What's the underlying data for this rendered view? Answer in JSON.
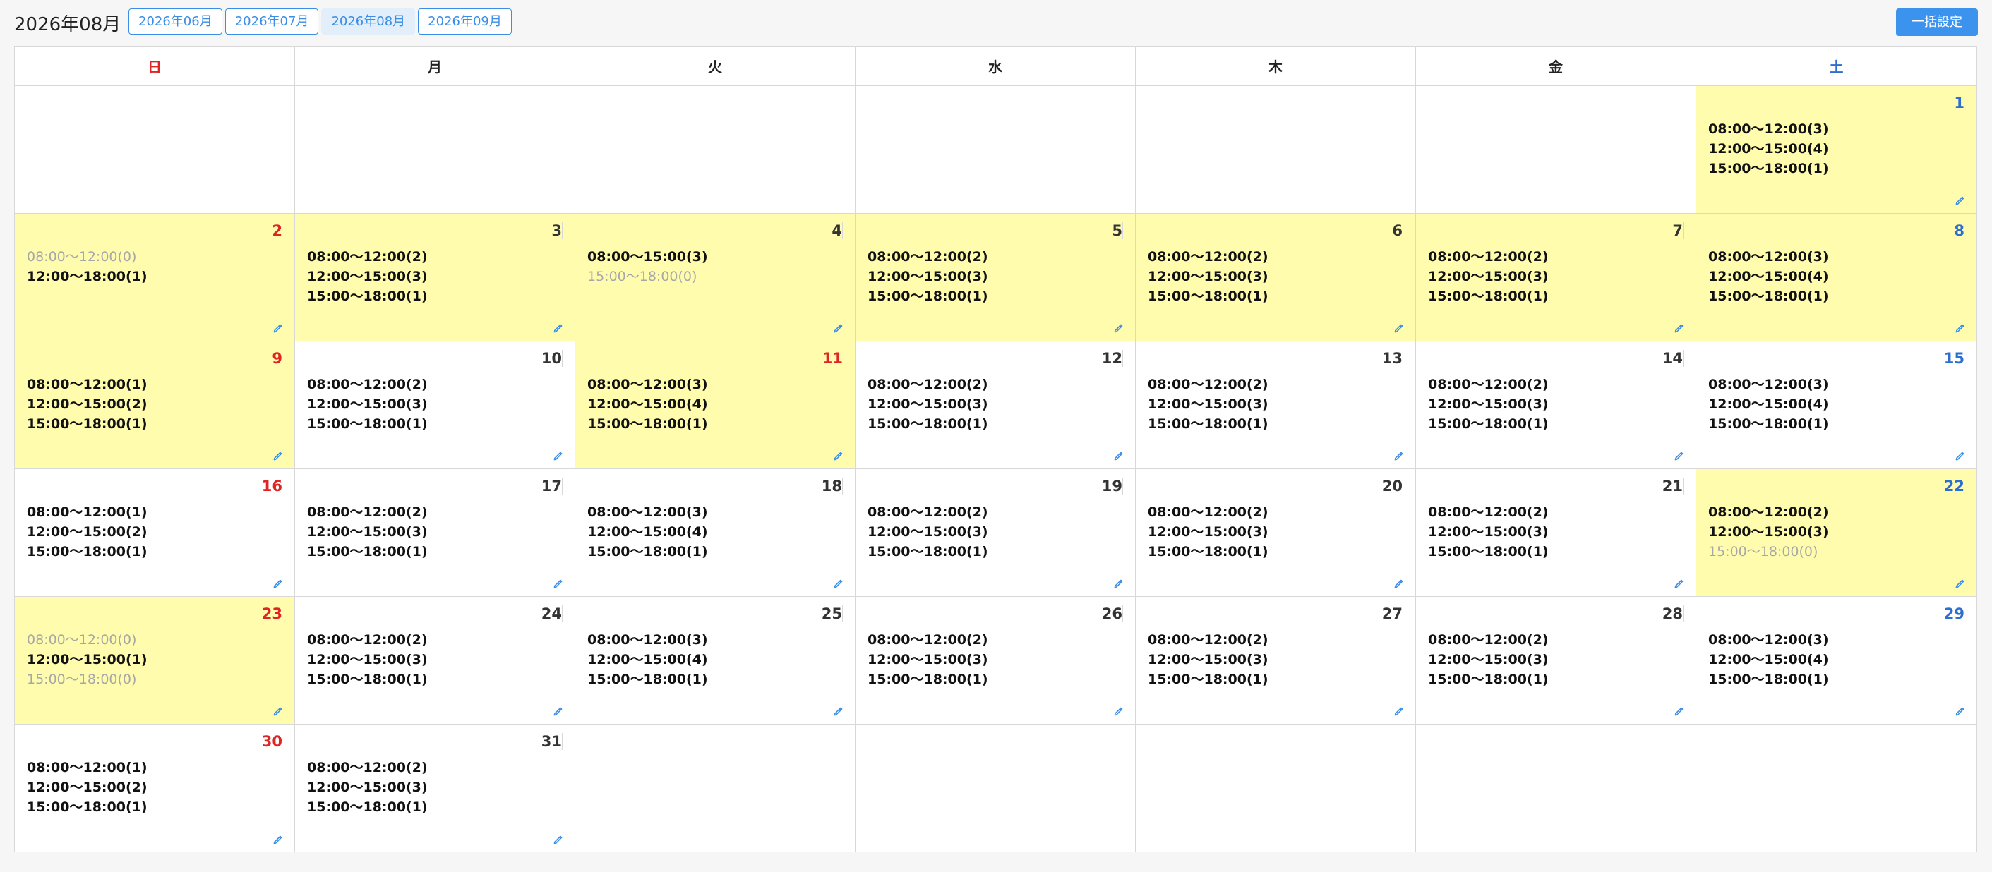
{
  "header": {
    "title": "2026年08月",
    "month_tabs": [
      {
        "label": "2026年06月",
        "active": false
      },
      {
        "label": "2026年07月",
        "active": false
      },
      {
        "label": "2026年08月",
        "active": true
      },
      {
        "label": "2026年09月",
        "active": false
      }
    ],
    "bulk_button_label": "一括設定"
  },
  "colors": {
    "accent": "#3b93ee",
    "highlight": "#fffcae",
    "sunday": "#e02424",
    "saturday": "#2d6fd0"
  },
  "calendar": {
    "weekdays": [
      "日",
      "月",
      "火",
      "水",
      "木",
      "金",
      "土"
    ],
    "weeks": [
      [
        null,
        null,
        null,
        null,
        null,
        null,
        {
          "date": 1,
          "highlight": true,
          "day_type": "sat",
          "slots": [
            {
              "text": "08:00〜12:00(3)",
              "zero": false
            },
            {
              "text": "12:00〜15:00(4)",
              "zero": false
            },
            {
              "text": "15:00〜18:00(1)",
              "zero": false
            }
          ]
        }
      ],
      [
        {
          "date": 2,
          "highlight": true,
          "day_type": "sun",
          "slots": [
            {
              "text": "08:00〜12:00(0)",
              "zero": true
            },
            {
              "text": "12:00〜18:00(1)",
              "zero": false
            }
          ]
        },
        {
          "date": 3,
          "highlight": true,
          "day_type": "weekday",
          "slots": [
            {
              "text": "08:00〜12:00(2)",
              "zero": false
            },
            {
              "text": "12:00〜15:00(3)",
              "zero": false
            },
            {
              "text": "15:00〜18:00(1)",
              "zero": false
            }
          ]
        },
        {
          "date": 4,
          "highlight": true,
          "day_type": "weekday",
          "slots": [
            {
              "text": "08:00〜15:00(3)",
              "zero": false
            },
            {
              "text": "15:00〜18:00(0)",
              "zero": true
            }
          ]
        },
        {
          "date": 5,
          "highlight": true,
          "day_type": "weekday",
          "slots": [
            {
              "text": "08:00〜12:00(2)",
              "zero": false
            },
            {
              "text": "12:00〜15:00(3)",
              "zero": false
            },
            {
              "text": "15:00〜18:00(1)",
              "zero": false
            }
          ]
        },
        {
          "date": 6,
          "highlight": true,
          "day_type": "weekday",
          "slots": [
            {
              "text": "08:00〜12:00(2)",
              "zero": false
            },
            {
              "text": "12:00〜15:00(3)",
              "zero": false
            },
            {
              "text": "15:00〜18:00(1)",
              "zero": false
            }
          ]
        },
        {
          "date": 7,
          "highlight": true,
          "day_type": "weekday",
          "slots": [
            {
              "text": "08:00〜12:00(2)",
              "zero": false
            },
            {
              "text": "12:00〜15:00(3)",
              "zero": false
            },
            {
              "text": "15:00〜18:00(1)",
              "zero": false
            }
          ]
        },
        {
          "date": 8,
          "highlight": true,
          "day_type": "sat",
          "slots": [
            {
              "text": "08:00〜12:00(3)",
              "zero": false
            },
            {
              "text": "12:00〜15:00(4)",
              "zero": false
            },
            {
              "text": "15:00〜18:00(1)",
              "zero": false
            }
          ]
        }
      ],
      [
        {
          "date": 9,
          "highlight": true,
          "day_type": "sun",
          "slots": [
            {
              "text": "08:00〜12:00(1)",
              "zero": false
            },
            {
              "text": "12:00〜15:00(2)",
              "zero": false
            },
            {
              "text": "15:00〜18:00(1)",
              "zero": false
            }
          ]
        },
        {
          "date": 10,
          "highlight": false,
          "day_type": "weekday",
          "slots": [
            {
              "text": "08:00〜12:00(2)",
              "zero": false
            },
            {
              "text": "12:00〜15:00(3)",
              "zero": false
            },
            {
              "text": "15:00〜18:00(1)",
              "zero": false
            }
          ]
        },
        {
          "date": 11,
          "highlight": true,
          "day_type": "holiday",
          "slots": [
            {
              "text": "08:00〜12:00(3)",
              "zero": false
            },
            {
              "text": "12:00〜15:00(4)",
              "zero": false
            },
            {
              "text": "15:00〜18:00(1)",
              "zero": false
            }
          ]
        },
        {
          "date": 12,
          "highlight": false,
          "day_type": "weekday",
          "slots": [
            {
              "text": "08:00〜12:00(2)",
              "zero": false
            },
            {
              "text": "12:00〜15:00(3)",
              "zero": false
            },
            {
              "text": "15:00〜18:00(1)",
              "zero": false
            }
          ]
        },
        {
          "date": 13,
          "highlight": false,
          "day_type": "weekday",
          "slots": [
            {
              "text": "08:00〜12:00(2)",
              "zero": false
            },
            {
              "text": "12:00〜15:00(3)",
              "zero": false
            },
            {
              "text": "15:00〜18:00(1)",
              "zero": false
            }
          ]
        },
        {
          "date": 14,
          "highlight": false,
          "day_type": "weekday",
          "slots": [
            {
              "text": "08:00〜12:00(2)",
              "zero": false
            },
            {
              "text": "12:00〜15:00(3)",
              "zero": false
            },
            {
              "text": "15:00〜18:00(1)",
              "zero": false
            }
          ]
        },
        {
          "date": 15,
          "highlight": false,
          "day_type": "sat",
          "slots": [
            {
              "text": "08:00〜12:00(3)",
              "zero": false
            },
            {
              "text": "12:00〜15:00(4)",
              "zero": false
            },
            {
              "text": "15:00〜18:00(1)",
              "zero": false
            }
          ]
        }
      ],
      [
        {
          "date": 16,
          "highlight": false,
          "day_type": "sun",
          "slots": [
            {
              "text": "08:00〜12:00(1)",
              "zero": false
            },
            {
              "text": "12:00〜15:00(2)",
              "zero": false
            },
            {
              "text": "15:00〜18:00(1)",
              "zero": false
            }
          ]
        },
        {
          "date": 17,
          "highlight": false,
          "day_type": "weekday",
          "slots": [
            {
              "text": "08:00〜12:00(2)",
              "zero": false
            },
            {
              "text": "12:00〜15:00(3)",
              "zero": false
            },
            {
              "text": "15:00〜18:00(1)",
              "zero": false
            }
          ]
        },
        {
          "date": 18,
          "highlight": false,
          "day_type": "weekday",
          "slots": [
            {
              "text": "08:00〜12:00(3)",
              "zero": false
            },
            {
              "text": "12:00〜15:00(4)",
              "zero": false
            },
            {
              "text": "15:00〜18:00(1)",
              "zero": false
            }
          ]
        },
        {
          "date": 19,
          "highlight": false,
          "day_type": "weekday",
          "slots": [
            {
              "text": "08:00〜12:00(2)",
              "zero": false
            },
            {
              "text": "12:00〜15:00(3)",
              "zero": false
            },
            {
              "text": "15:00〜18:00(1)",
              "zero": false
            }
          ]
        },
        {
          "date": 20,
          "highlight": false,
          "day_type": "weekday",
          "slots": [
            {
              "text": "08:00〜12:00(2)",
              "zero": false
            },
            {
              "text": "12:00〜15:00(3)",
              "zero": false
            },
            {
              "text": "15:00〜18:00(1)",
              "zero": false
            }
          ]
        },
        {
          "date": 21,
          "highlight": false,
          "day_type": "weekday",
          "slots": [
            {
              "text": "08:00〜12:00(2)",
              "zero": false
            },
            {
              "text": "12:00〜15:00(3)",
              "zero": false
            },
            {
              "text": "15:00〜18:00(1)",
              "zero": false
            }
          ]
        },
        {
          "date": 22,
          "highlight": true,
          "day_type": "sat",
          "slots": [
            {
              "text": "08:00〜12:00(2)",
              "zero": false
            },
            {
              "text": "12:00〜15:00(3)",
              "zero": false
            },
            {
              "text": "15:00〜18:00(0)",
              "zero": true
            }
          ]
        }
      ],
      [
        {
          "date": 23,
          "highlight": true,
          "day_type": "sun",
          "slots": [
            {
              "text": "08:00〜12:00(0)",
              "zero": true
            },
            {
              "text": "12:00〜15:00(1)",
              "zero": false
            },
            {
              "text": "15:00〜18:00(0)",
              "zero": true
            }
          ]
        },
        {
          "date": 24,
          "highlight": false,
          "day_type": "weekday",
          "slots": [
            {
              "text": "08:00〜12:00(2)",
              "zero": false
            },
            {
              "text": "12:00〜15:00(3)",
              "zero": false
            },
            {
              "text": "15:00〜18:00(1)",
              "zero": false
            }
          ]
        },
        {
          "date": 25,
          "highlight": false,
          "day_type": "weekday",
          "slots": [
            {
              "text": "08:00〜12:00(3)",
              "zero": false
            },
            {
              "text": "12:00〜15:00(4)",
              "zero": false
            },
            {
              "text": "15:00〜18:00(1)",
              "zero": false
            }
          ]
        },
        {
          "date": 26,
          "highlight": false,
          "day_type": "weekday",
          "slots": [
            {
              "text": "08:00〜12:00(2)",
              "zero": false
            },
            {
              "text": "12:00〜15:00(3)",
              "zero": false
            },
            {
              "text": "15:00〜18:00(1)",
              "zero": false
            }
          ]
        },
        {
          "date": 27,
          "highlight": false,
          "day_type": "weekday",
          "slots": [
            {
              "text": "08:00〜12:00(2)",
              "zero": false
            },
            {
              "text": "12:00〜15:00(3)",
              "zero": false
            },
            {
              "text": "15:00〜18:00(1)",
              "zero": false
            }
          ]
        },
        {
          "date": 28,
          "highlight": false,
          "day_type": "weekday",
          "slots": [
            {
              "text": "08:00〜12:00(2)",
              "zero": false
            },
            {
              "text": "12:00〜15:00(3)",
              "zero": false
            },
            {
              "text": "15:00〜18:00(1)",
              "zero": false
            }
          ]
        },
        {
          "date": 29,
          "highlight": false,
          "day_type": "sat",
          "slots": [
            {
              "text": "08:00〜12:00(3)",
              "zero": false
            },
            {
              "text": "12:00〜15:00(4)",
              "zero": false
            },
            {
              "text": "15:00〜18:00(1)",
              "zero": false
            }
          ]
        }
      ],
      [
        {
          "date": 30,
          "highlight": false,
          "day_type": "sun",
          "slots": [
            {
              "text": "08:00〜12:00(1)",
              "zero": false
            },
            {
              "text": "12:00〜15:00(2)",
              "zero": false
            },
            {
              "text": "15:00〜18:00(1)",
              "zero": false
            }
          ]
        },
        {
          "date": 31,
          "highlight": false,
          "day_type": "weekday",
          "slots": [
            {
              "text": "08:00〜12:00(2)",
              "zero": false
            },
            {
              "text": "12:00〜15:00(3)",
              "zero": false
            },
            {
              "text": "15:00〜18:00(1)",
              "zero": false
            }
          ]
        },
        null,
        null,
        null,
        null,
        null
      ]
    ]
  }
}
